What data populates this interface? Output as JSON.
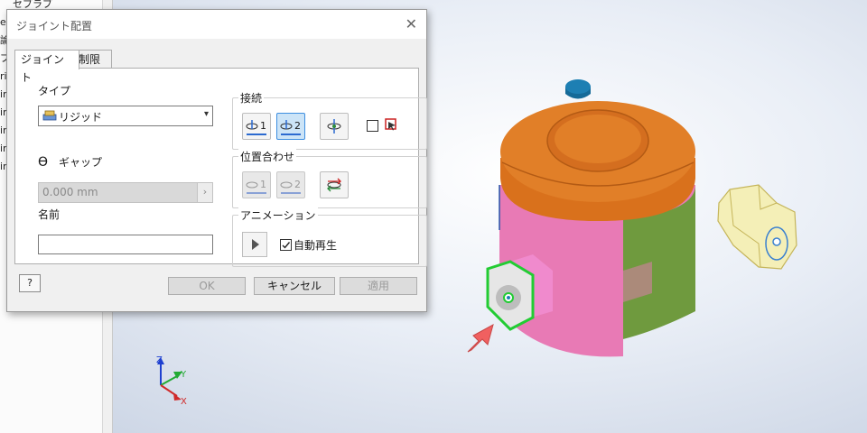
{
  "browser": {
    "items": [
      "e",
      "論",
      "ブ",
      "ri",
      "in",
      "in",
      "in",
      "in",
      "in"
    ],
    "top_label": "セブラブ"
  },
  "dialog": {
    "title": "ジョイント配置",
    "tabs": [
      "ジョイント",
      "制限"
    ],
    "type_label": "タイプ",
    "type_value": "リジッド",
    "gap_label": "ギャップ",
    "gap_value": "0.000 mm",
    "name_label": "名前",
    "name_value": "",
    "connect": {
      "title": "接続",
      "btn1": "1",
      "btn2": "2"
    },
    "align": {
      "title": "位置合わせ",
      "btn1": "1",
      "btn2": "2"
    },
    "animation": {
      "title": "アニメーション",
      "autoplay_label": "自動再生",
      "autoplay_checked": true
    },
    "buttons": {
      "help": "?",
      "ok": "OK",
      "cancel": "キャンセル",
      "apply": "適用"
    }
  },
  "triad": {
    "z": "Z",
    "y": "Y",
    "x": "X"
  },
  "colors": {
    "pink": "#e87ab5",
    "green": "#6f9a3e",
    "orange": "#d9711c",
    "blue_knob": "#1d7fb3",
    "arrow": "#f06060",
    "highlight": "#22cc33"
  }
}
